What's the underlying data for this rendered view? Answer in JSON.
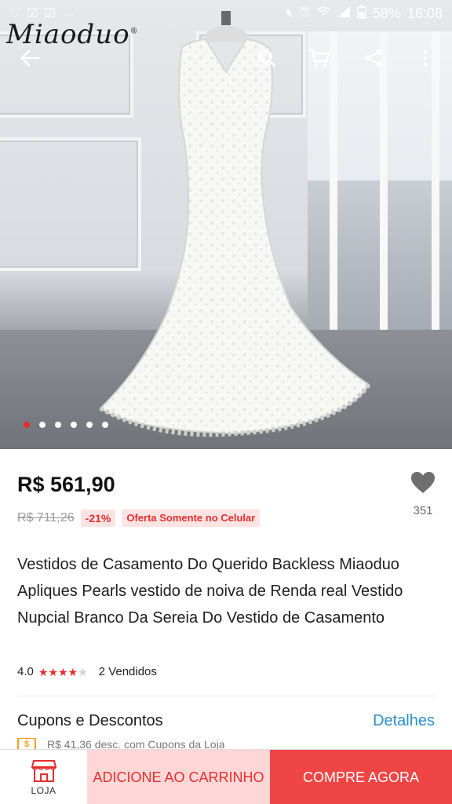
{
  "status_bar": {
    "battery": "58%",
    "time": "16:08",
    "left_icons": [
      "heart-outline-icon",
      "checkbox-icon",
      "checkbox-icon",
      "more-notifications-icon"
    ],
    "right_icons": [
      "mute-icon",
      "alarm-icon",
      "wifi-icon",
      "signal-icon",
      "battery-icon"
    ]
  },
  "brand": {
    "logo_text": "Miaoduo",
    "logo_mark": "®"
  },
  "top_bar": {
    "icons": [
      "back-arrow-icon",
      "search-icon",
      "cart-icon",
      "share-icon",
      "more-vert-icon"
    ]
  },
  "gallery": {
    "slides": 6,
    "active_index": 0,
    "accent": "#e62e2e"
  },
  "product": {
    "price": "R$ 561,90",
    "old_price": "R$ 711,26",
    "discount": "-21%",
    "mobile_offer": "Oferta Somente no Celular",
    "wishlist_count": "351",
    "title": "Vestidos de Casamento Do Querido Backless Miaoduo Apliques Pearls vestido de noiva de Renda real Vestido Nupcial Branco Da Sereia Do Vestido de Casamento",
    "rating": "4.0",
    "stars_filled": 4,
    "stars_total": 5,
    "sold": "2 Vendidos"
  },
  "coupons": {
    "title": "Cupons e Descontos",
    "link": "Detalhes",
    "line": "R$ 41,36 desc. com Cupons da Loja"
  },
  "bottom_bar": {
    "store_label": "LOJA",
    "add_to_cart": "ADICIONE AO CARRINHO",
    "buy_now": "COMPRE AGORA"
  },
  "colors": {
    "accent": "#e62e2e",
    "link": "#2b8fcb",
    "cart_bg": "#ffd7d7",
    "buy_bg": "#f04545"
  }
}
